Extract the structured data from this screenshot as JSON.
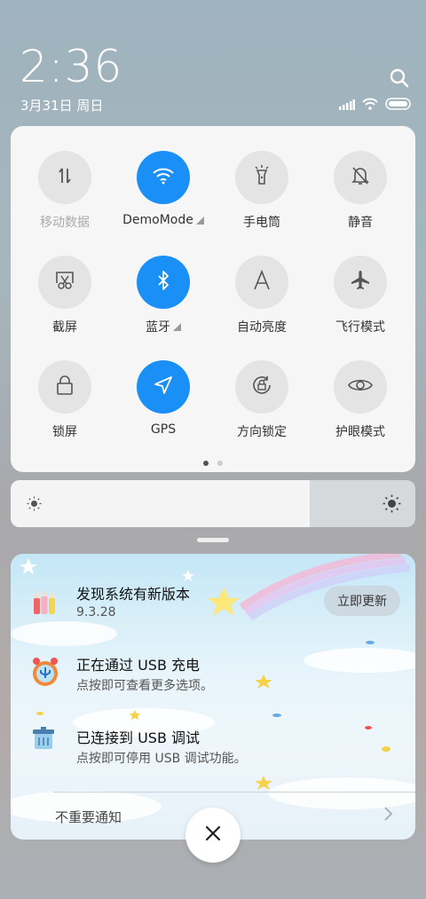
{
  "status": {
    "time": "2:36",
    "date": "3月31日 周日"
  },
  "quick_settings": {
    "tiles": [
      {
        "label": "移动数据",
        "icon": "mobile-data-icon",
        "active": false,
        "dim": true
      },
      {
        "label": "DemoMode",
        "icon": "wifi-icon",
        "active": true,
        "expand": true
      },
      {
        "label": "手电筒",
        "icon": "flashlight-icon",
        "active": false
      },
      {
        "label": "静音",
        "icon": "mute-bell-icon",
        "active": false
      },
      {
        "label": "截屏",
        "icon": "screenshot-icon",
        "active": false
      },
      {
        "label": "蓝牙",
        "icon": "bluetooth-icon",
        "active": true,
        "expand": true
      },
      {
        "label": "自动亮度",
        "icon": "auto-brightness-icon",
        "active": false
      },
      {
        "label": "飞行模式",
        "icon": "airplane-icon",
        "active": false
      },
      {
        "label": "锁屏",
        "icon": "lock-icon",
        "active": false
      },
      {
        "label": "GPS",
        "icon": "gps-icon",
        "active": true
      },
      {
        "label": "方向锁定",
        "icon": "rotation-lock-icon",
        "active": false
      },
      {
        "label": "护眼模式",
        "icon": "eye-icon",
        "active": false
      }
    ],
    "page_count": 2,
    "current_page": 1
  },
  "brightness": {
    "level": 0.74
  },
  "notifications": [
    {
      "title": "发现系统有新版本",
      "subtitle": "9.3.28",
      "icon": "update-pencils-icon",
      "action": "立即更新"
    },
    {
      "title": "正在通过 USB 充电",
      "subtitle": "点按即可查看更多选项。",
      "icon": "usb-charging-icon"
    },
    {
      "title": "已连接到 USB 调试",
      "subtitle": "点按即可停用 USB 调试功能。",
      "icon": "usb-debug-icon"
    }
  ],
  "footer": {
    "unimportant_label": "不重要通知"
  },
  "colors": {
    "accent": "#1a8ff5",
    "tile_off": "#e4e4e4"
  }
}
